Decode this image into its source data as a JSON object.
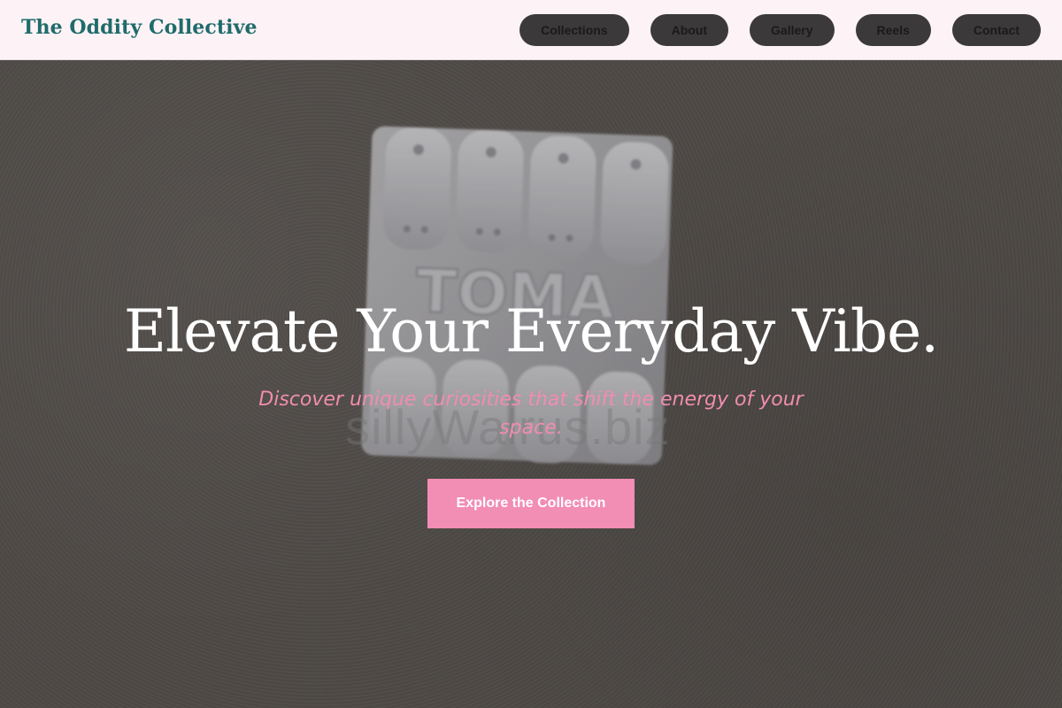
{
  "header": {
    "brand": "The Oddity Collective",
    "nav": [
      {
        "label": "Collections"
      },
      {
        "label": "About"
      },
      {
        "label": "Gallery"
      },
      {
        "label": "Reels"
      },
      {
        "label": "Contact"
      }
    ]
  },
  "hero": {
    "title": "Elevate Your Everyday Vibe.",
    "subtitle": "Discover unique curiosities that shift the energy of your space.",
    "cta_label": "Explore the Collection",
    "image_lettering": "TOMA",
    "watermark": "sillyWalrus.biz"
  },
  "colors": {
    "header_bg": "#fdf2f5",
    "brand": "#1f6b6b",
    "nav_pill": "#3b393a",
    "accent_pink": "#f28db4",
    "subtitle_pink": "#f08db0",
    "title": "#ffffff"
  }
}
